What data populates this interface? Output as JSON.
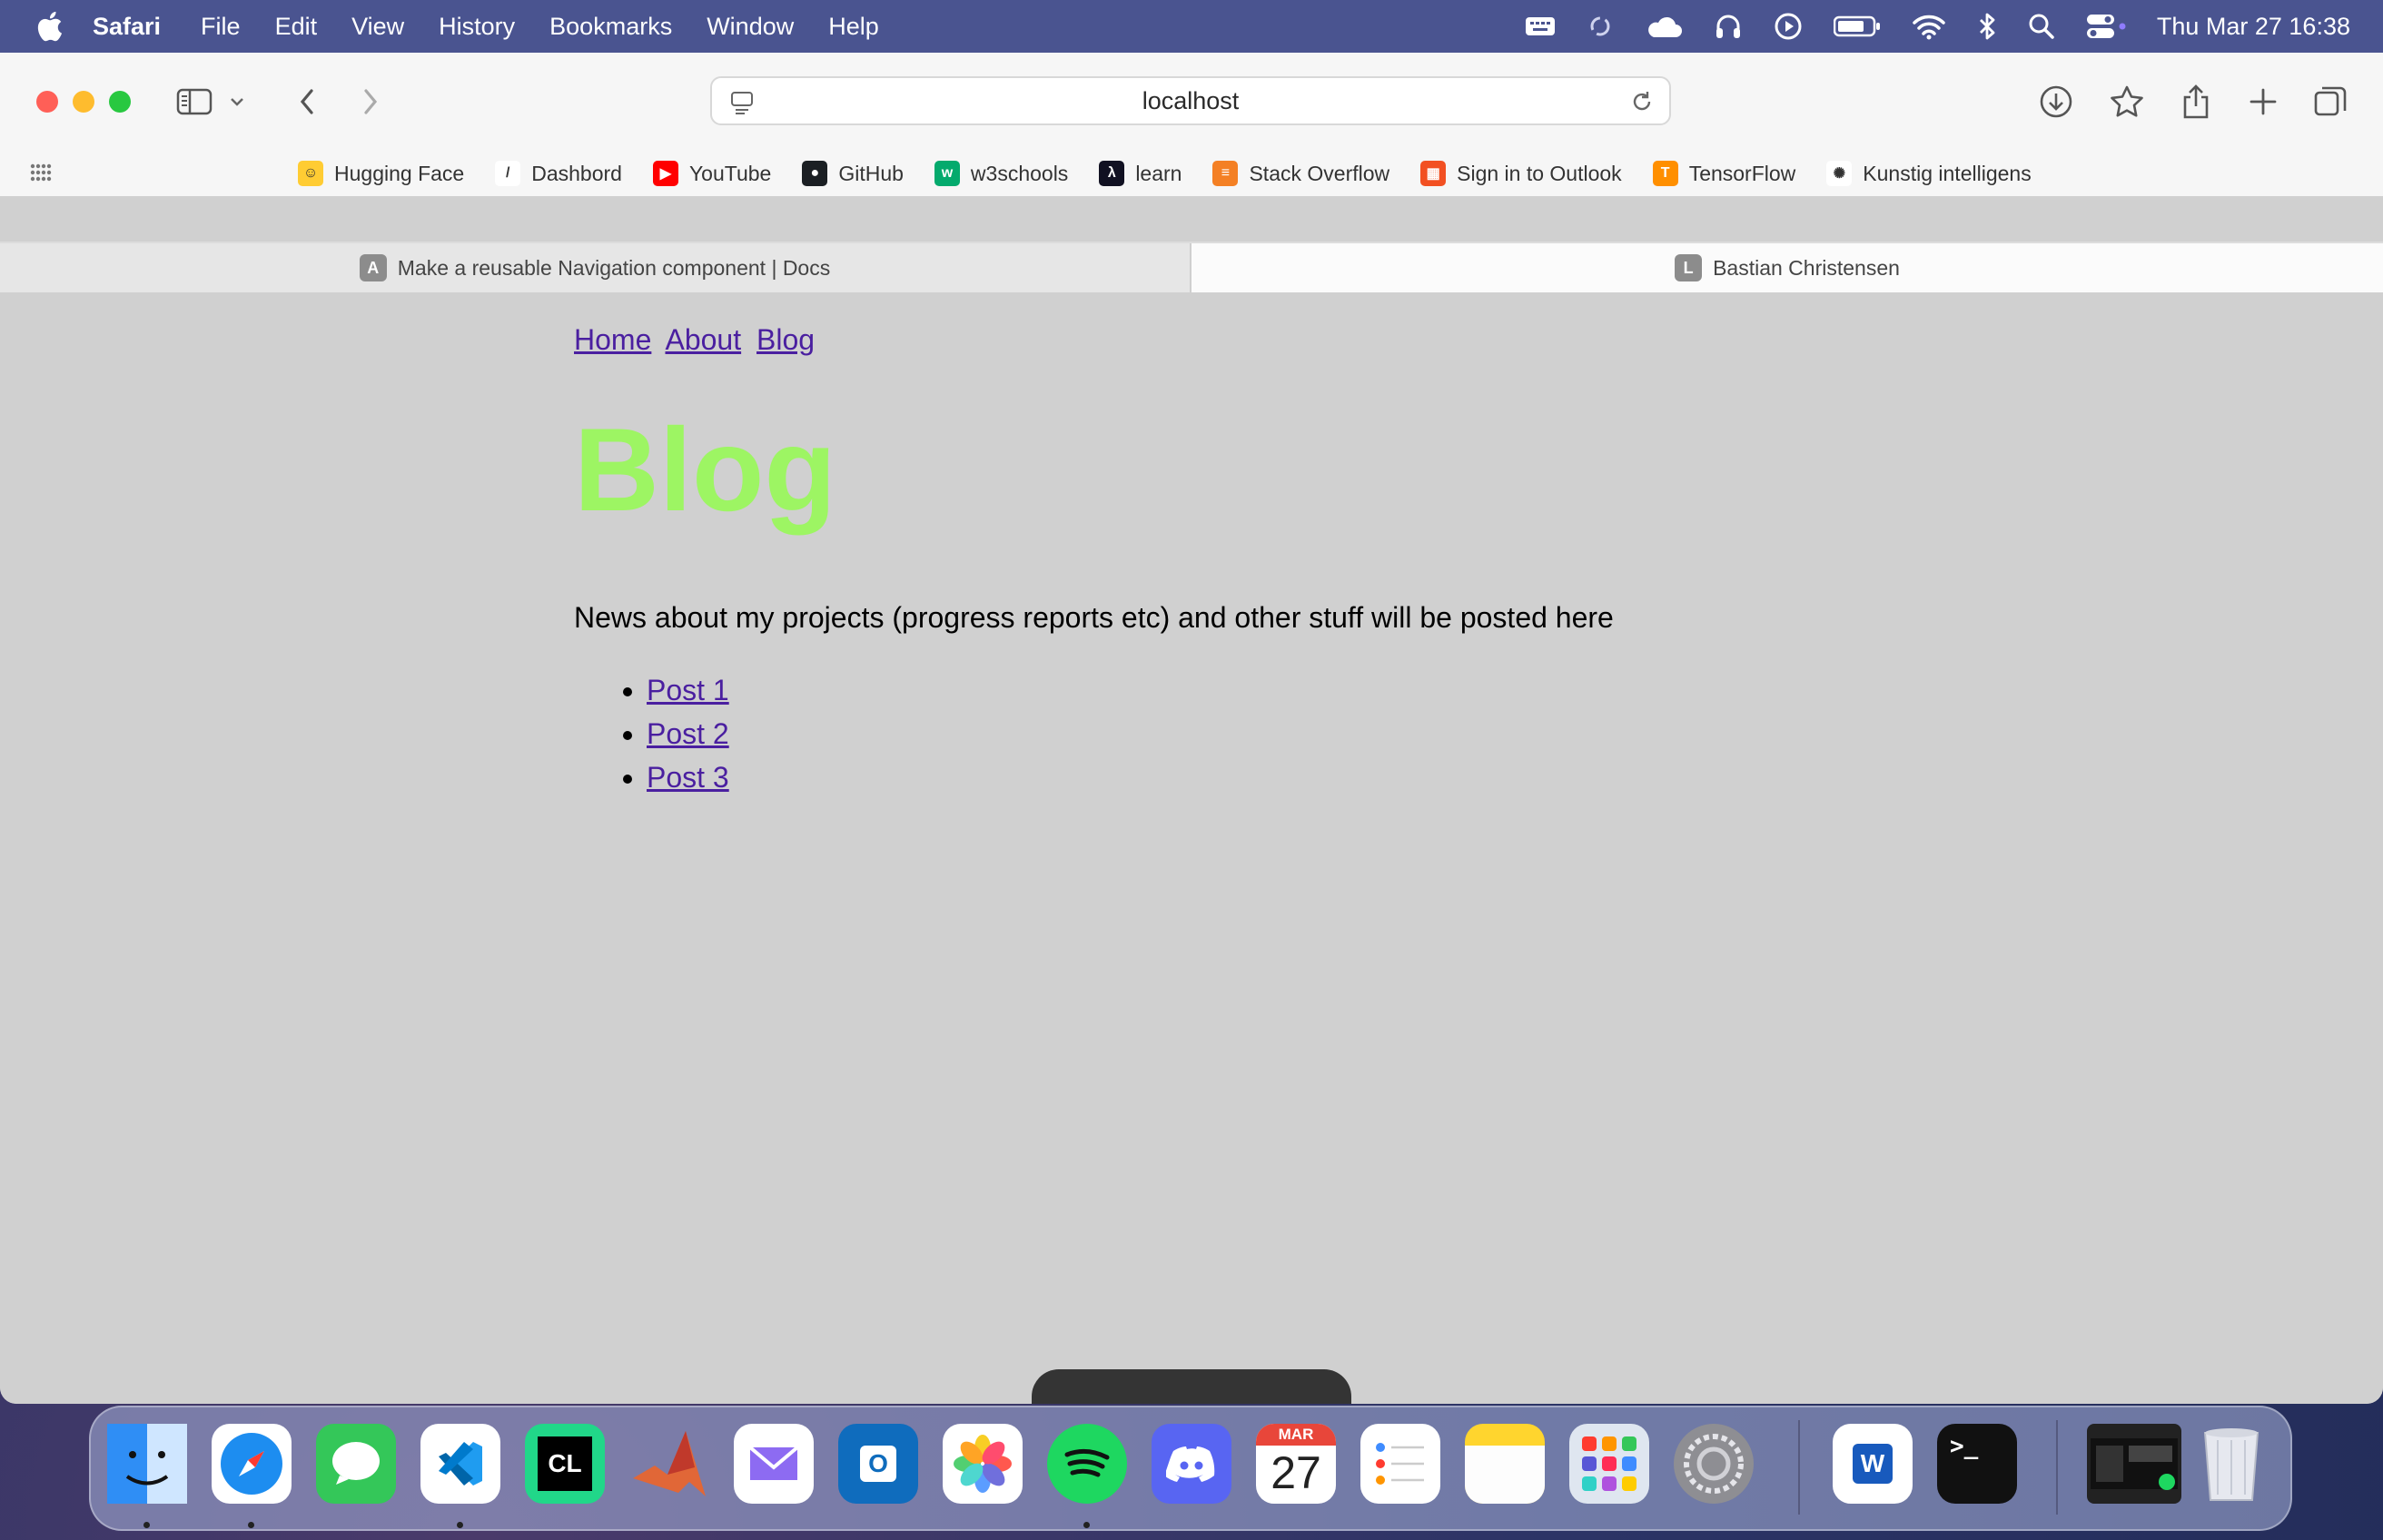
{
  "menubar": {
    "app_name": "Safari",
    "menus": [
      "File",
      "Edit",
      "View",
      "History",
      "Bookmarks",
      "Window",
      "Help"
    ],
    "clock": "Thu Mar 27  16:38"
  },
  "toolbar": {
    "url": "localhost"
  },
  "bookmarks": [
    {
      "label": "Hugging Face",
      "icon": "hugging-face-icon",
      "color": "#ffcc33",
      "glyph": "☺"
    },
    {
      "label": "Dashbord",
      "icon": "dashbord-icon",
      "color": "#ffffff",
      "glyph": "/"
    },
    {
      "label": "YouTube",
      "icon": "youtube-icon",
      "color": "#ff0000",
      "glyph": "▶"
    },
    {
      "label": "GitHub",
      "icon": "github-icon",
      "color": "#1b1f23",
      "glyph": "●"
    },
    {
      "label": "w3schools",
      "icon": "w3schools-icon",
      "color": "#04aa6d",
      "glyph": "w"
    },
    {
      "label": "learn",
      "icon": "learn-icon",
      "color": "#111122",
      "glyph": "λ"
    },
    {
      "label": "Stack Overflow",
      "icon": "stack-overflow-icon",
      "color": "#f48024",
      "glyph": "≡"
    },
    {
      "label": "Sign in to Outlook",
      "icon": "microsoft-icon",
      "color": "#f25022",
      "glyph": "▦"
    },
    {
      "label": "TensorFlow",
      "icon": "tensorflow-icon",
      "color": "#ff8f00",
      "glyph": "T"
    },
    {
      "label": "Kunstig intelligens",
      "icon": "openai-icon",
      "color": "#ffffff",
      "glyph": "✺"
    }
  ],
  "tabs": [
    {
      "label": "Make a reusable Navigation component | Docs",
      "fav": "A"
    },
    {
      "label": "Bastian Christensen",
      "fav": "L"
    }
  ],
  "page": {
    "nav": [
      "Home",
      "About",
      "Blog"
    ],
    "title": "Blog",
    "intro": "News about my projects (progress reports etc) and other stuff will be posted here",
    "posts": [
      "Post 1",
      "Post 2",
      "Post 3"
    ]
  },
  "dock": {
    "calendar_month": "MAR",
    "calendar_day": "27",
    "apps": [
      {
        "name": "finder-icon",
        "color": "#2f8ef5"
      },
      {
        "name": "safari-icon",
        "color": "#1d8df0"
      },
      {
        "name": "messages-icon",
        "color": "#34c759"
      },
      {
        "name": "vscode-icon",
        "color": "#ffffff"
      },
      {
        "name": "clion-icon",
        "color": "#21d789"
      },
      {
        "name": "matlab-icon",
        "color": "#e16737"
      },
      {
        "name": "mail-icon",
        "color": "#ffffff"
      },
      {
        "name": "outlook-icon",
        "color": "#0f6cbd"
      },
      {
        "name": "photos-icon",
        "color": "#ffffff"
      },
      {
        "name": "spotify-icon",
        "color": "#1ed760"
      },
      {
        "name": "discord-icon",
        "color": "#5865f2"
      },
      {
        "name": "calendar-icon",
        "color": "#ffffff"
      },
      {
        "name": "reminders-icon",
        "color": "#ffffff"
      },
      {
        "name": "notes-icon",
        "color": "#ffd52e"
      },
      {
        "name": "launchpad-icon",
        "color": "#dfe6f0"
      },
      {
        "name": "system-settings-icon",
        "color": "#8e8e93"
      },
      {
        "name": "word-icon",
        "color": "#ffffff"
      },
      {
        "name": "terminal-icon",
        "color": "#111111"
      },
      {
        "name": "screenshot-preview-icon",
        "color": "#222222"
      },
      {
        "name": "trash-icon",
        "color": "#e8eaf0"
      }
    ]
  }
}
